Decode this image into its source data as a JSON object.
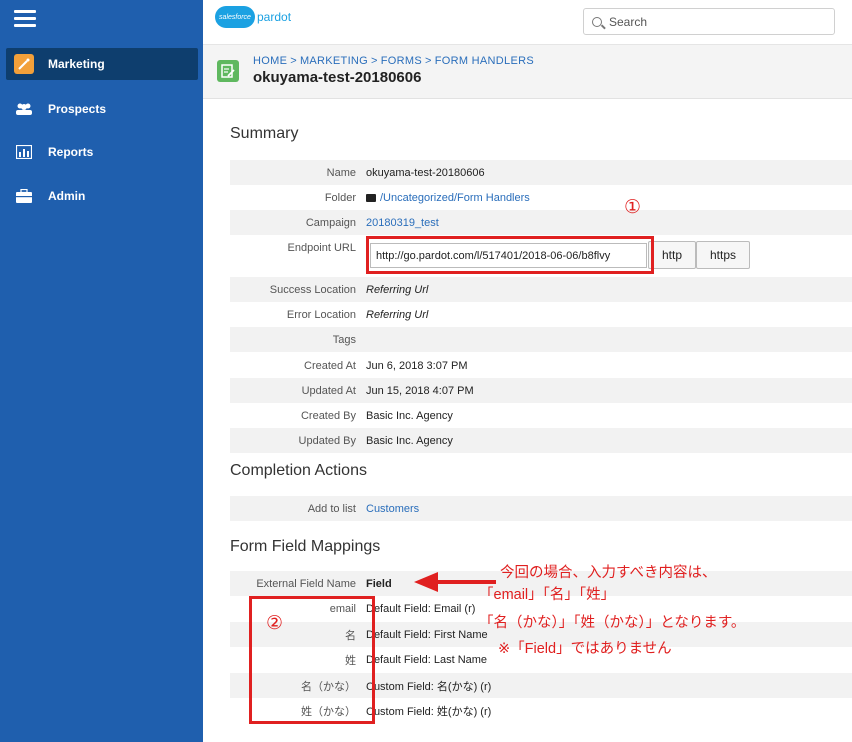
{
  "sidebar": {
    "items": [
      {
        "label": "Marketing",
        "icon": "wand-icon"
      },
      {
        "label": "Prospects",
        "icon": "people-icon"
      },
      {
        "label": "Reports",
        "icon": "chart-icon"
      },
      {
        "label": "Admin",
        "icon": "briefcase-icon"
      }
    ]
  },
  "topbar": {
    "logo_brand": "salesforce",
    "logo_product": "pardot",
    "search_placeholder": "Search"
  },
  "header": {
    "breadcrumb": [
      "HOME",
      "MARKETING",
      "FORMS",
      "FORM HANDLERS"
    ],
    "breadcrumb_sep": ">",
    "title": "okuyama-test-20180606"
  },
  "summary": {
    "title": "Summary",
    "name_label": "Name",
    "name_value": "okuyama-test-20180606",
    "folder_label": "Folder",
    "folder_value": "/Uncategorized/Form Handlers",
    "campaign_label": "Campaign",
    "campaign_value": "20180319_test",
    "endpoint_label": "Endpoint URL",
    "endpoint_value": "http://go.pardot.com/l/517401/2018-06-06/b8flvy",
    "http_label": "http",
    "https_label": "https",
    "success_label": "Success Location",
    "success_value": "Referring Url",
    "error_label": "Error Location",
    "error_value": "Referring Url",
    "tags_label": "Tags",
    "tags_value": "",
    "created_at_label": "Created At",
    "created_at_value": "Jun 6, 2018 3:07 PM",
    "updated_at_label": "Updated At",
    "updated_at_value": "Jun 15, 2018 4:07 PM",
    "created_by_label": "Created By",
    "created_by_value": "Basic Inc. Agency",
    "updated_by_label": "Updated By",
    "updated_by_value": "Basic Inc. Agency"
  },
  "completion": {
    "title": "Completion Actions",
    "add_label": "Add to list",
    "add_value": "Customers"
  },
  "mappings": {
    "title": "Form Field Mappings",
    "header_label": "External Field Name",
    "header_value": "Field",
    "rows": [
      {
        "label": "email",
        "value": "Default Field: Email (r)"
      },
      {
        "label": "名",
        "value": "Default Field: First Name"
      },
      {
        "label": "姓",
        "value": "Default Field: Last Name"
      },
      {
        "label": "名（かな）",
        "value": "Custom Field: 名(かな) (r)"
      },
      {
        "label": "姓（かな）",
        "value": "Custom Field: 姓(かな) (r)"
      }
    ]
  },
  "annotations": {
    "circle1": "①",
    "circle2": "②",
    "line1": "今回の場合、入力すべき内容は、",
    "line2": "「email」「名」「姓」",
    "line3": "「名（かな）」「姓（かな）」となります。",
    "line4": "※「Field」ではありません"
  },
  "colors": {
    "sidebar": "#1f5fae",
    "sidebar_active": "#0e3e6e",
    "link": "#2a6ebb",
    "annotation": "#e02020"
  }
}
